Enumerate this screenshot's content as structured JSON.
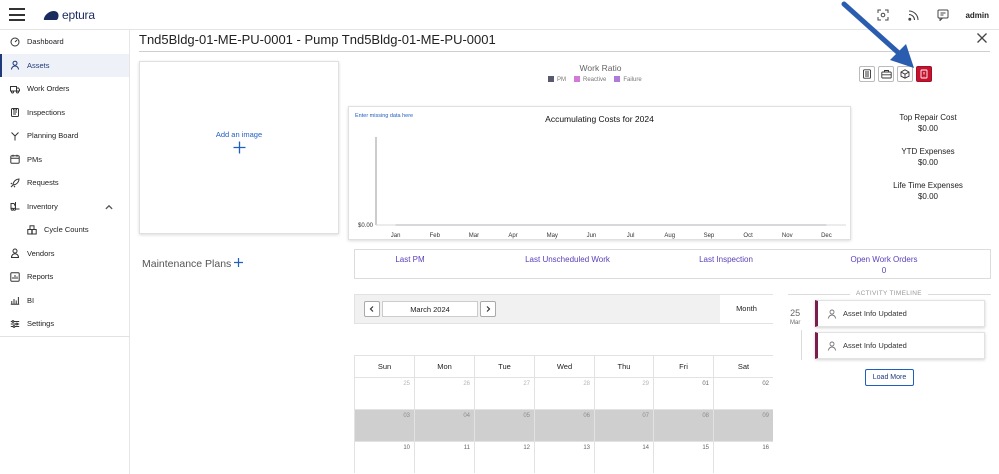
{
  "topbar": {
    "brand": "eptura",
    "user": "admin",
    "icons": [
      "scan-icon",
      "rss-icon",
      "chat-icon"
    ]
  },
  "sidebar": {
    "items": [
      {
        "label": "Dashboard",
        "icon": "gauge-icon"
      },
      {
        "label": "Assets",
        "icon": "asset-icon",
        "active": true
      },
      {
        "label": "Work Orders",
        "icon": "truck-icon"
      },
      {
        "label": "Inspections",
        "icon": "clipboard-icon"
      },
      {
        "label": "Planning Board",
        "icon": "branch-icon"
      },
      {
        "label": "PMs",
        "icon": "calendar-icon"
      },
      {
        "label": "Requests",
        "icon": "rocket-icon"
      },
      {
        "label": "Inventory",
        "icon": "forklift-icon",
        "expanded": true
      },
      {
        "label": "Cycle Counts",
        "icon": "boxes-icon",
        "sub": true
      },
      {
        "label": "Vendors",
        "icon": "vendor-icon"
      },
      {
        "label": "Reports",
        "icon": "report-icon"
      },
      {
        "label": "BI",
        "icon": "bi-icon"
      },
      {
        "label": "Settings",
        "icon": "sliders-icon"
      }
    ]
  },
  "page": {
    "title": "Tnd5Bldg-01-ME-PU-0001 - Pump Tnd5Bldg-01-ME-PU-0001"
  },
  "image_panel": {
    "label": "Add an image"
  },
  "maintenance": {
    "label": "Maintenance Plans"
  },
  "work_ratio": {
    "title": "Work Ratio",
    "legend": [
      {
        "label": "PM",
        "color": "#5a5a6e"
      },
      {
        "label": "Reactive",
        "color": "#d27ad8"
      },
      {
        "label": "Failure",
        "color": "#b07ad8"
      }
    ]
  },
  "toolbar": {
    "buttons": [
      "list-icon",
      "toolbox-icon",
      "cube-icon",
      "report-red-icon"
    ],
    "accent": "#c4122f"
  },
  "chart_data": {
    "type": "line",
    "title": "Accumulating Costs for 2024",
    "categories": [
      "Jan",
      "Feb",
      "Mar",
      "Apr",
      "May",
      "Jun",
      "Jul",
      "Aug",
      "Sep",
      "Oct",
      "Nov",
      "Dec"
    ],
    "values": [
      0,
      0,
      0,
      0,
      0,
      0,
      0,
      0,
      0,
      0,
      0,
      0
    ],
    "ytick_labels": [
      "$0.00"
    ],
    "ylim": [
      0,
      1
    ],
    "link": "Enter missing data here",
    "grid": false
  },
  "stats": [
    {
      "label": "Top Repair Cost",
      "value": "$0.00"
    },
    {
      "label": "YTD Expenses",
      "value": "$0.00"
    },
    {
      "label": "Life Time Expenses",
      "value": "$0.00"
    }
  ],
  "info_strip": {
    "last_pm": "Last PM",
    "last_unscheduled": "Last Unscheduled Work",
    "last_inspection": "Last Inspection",
    "open_work_orders": "Open Work Orders",
    "open_work_orders_count": "0"
  },
  "calendar": {
    "month": "March 2024",
    "view": "Month",
    "days": [
      "Sun",
      "Mon",
      "Tue",
      "Wed",
      "Thu",
      "Fri",
      "Sat"
    ],
    "weeks": [
      [
        {
          "d": "25",
          "o": true
        },
        {
          "d": "26",
          "o": true
        },
        {
          "d": "27",
          "o": true
        },
        {
          "d": "28",
          "o": true
        },
        {
          "d": "29",
          "o": true
        },
        {
          "d": "01"
        },
        {
          "d": "02"
        }
      ],
      [
        {
          "d": "03",
          "s": true
        },
        {
          "d": "04",
          "s": true
        },
        {
          "d": "05",
          "s": true
        },
        {
          "d": "06",
          "s": true
        },
        {
          "d": "07",
          "s": true
        },
        {
          "d": "08",
          "s": true
        },
        {
          "d": "09",
          "s": true
        }
      ],
      [
        {
          "d": "10"
        },
        {
          "d": "11"
        },
        {
          "d": "12"
        },
        {
          "d": "13"
        },
        {
          "d": "14"
        },
        {
          "d": "15"
        },
        {
          "d": "16"
        }
      ]
    ]
  },
  "timeline": {
    "heading": "ACTIVITY TIMELINE",
    "day": "25",
    "month": "Mar",
    "events": [
      "Asset Info Updated",
      "Asset Info Updated"
    ],
    "load_more": "Load More"
  }
}
